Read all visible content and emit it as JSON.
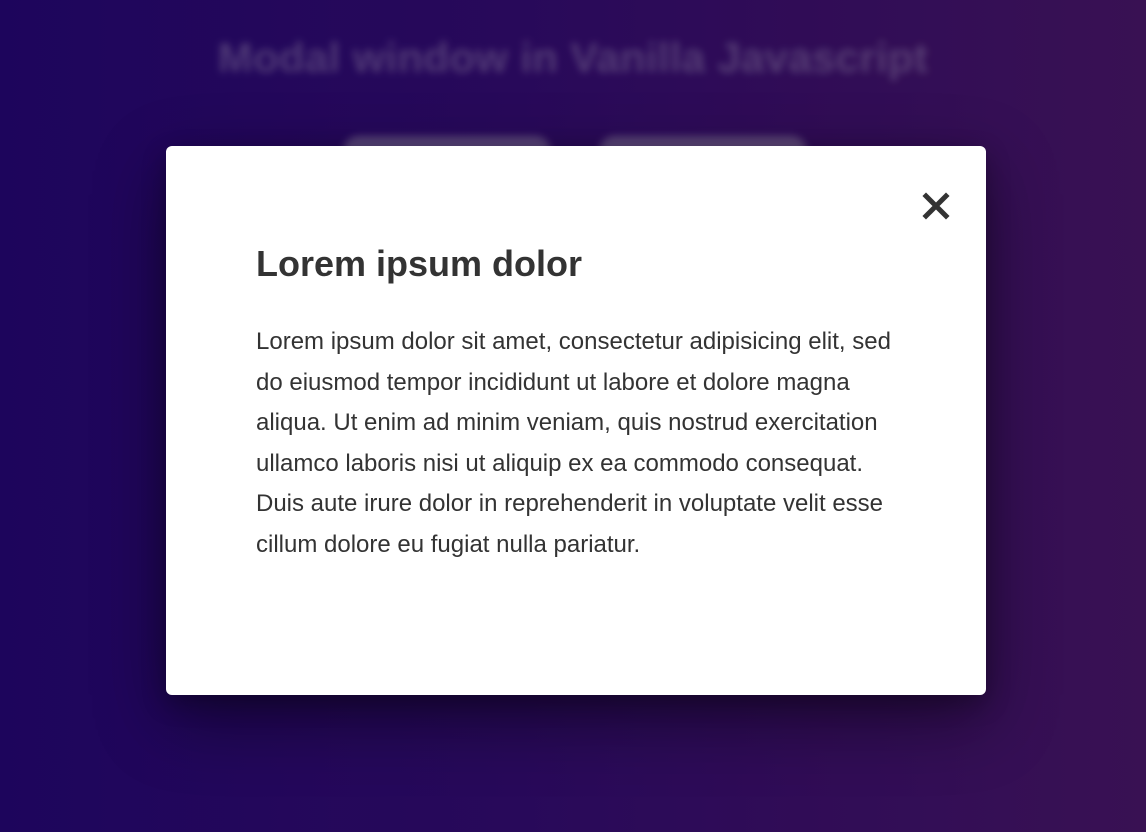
{
  "background": {
    "title": "Modal window in Vanilla Javascript",
    "buttons": [
      "",
      ""
    ]
  },
  "modal": {
    "title": "Lorem ipsum dolor",
    "body": "Lorem ipsum dolor sit amet, consectetur adipisicing elit, sed do eiusmod tempor incididunt ut labore et dolore magna aliqua. Ut enim ad minim veniam, quis nostrud exercitation ullamco laboris nisi ut aliquip ex ea commodo consequat. Duis aute irure dolor in reprehenderit in voluptate velit esse cillum dolore eu fugiat nulla pariatur.",
    "close_icon": "close-icon"
  },
  "colors": {
    "background_start": "#1e0660",
    "background_end": "#3c1356",
    "modal_background": "#ffffff",
    "text": "#333333"
  }
}
